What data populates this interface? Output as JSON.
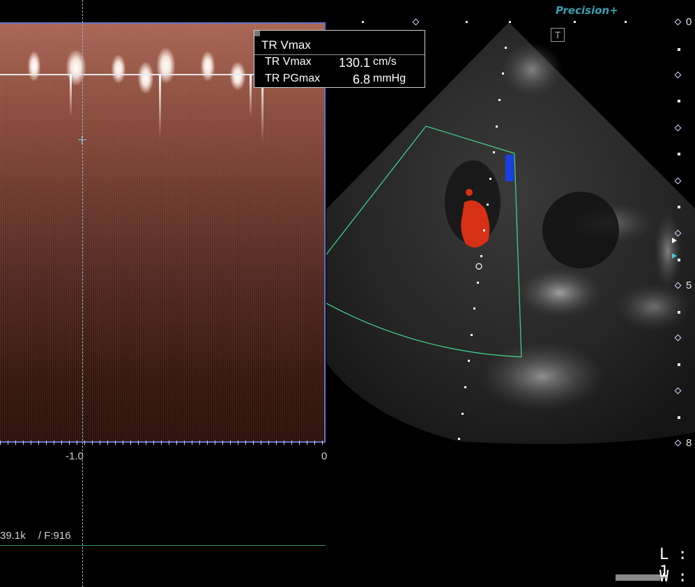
{
  "brand": "Precision+",
  "t_badge": "T",
  "measurement": {
    "title": "TR Vmax",
    "rows": [
      {
        "label": "TR Vmax",
        "value": "130.1",
        "unit": "cm/s"
      },
      {
        "label": "TR PGmax",
        "value": "6.8",
        "unit": "mmHg"
      }
    ]
  },
  "time_axis": {
    "ticks": [
      "-1.0",
      "0"
    ]
  },
  "depth_scale": {
    "labels": [
      "0",
      "5",
      "8"
    ]
  },
  "footer": {
    "scale_text": "39.1k",
    "frame_text": "/ F:916"
  },
  "window_level": {
    "level": "L : 1",
    "width": "W :"
  },
  "colors": {
    "spectrum": "#8f5040",
    "panel_border": "#6a72c8",
    "color_box": "#2fd07a",
    "flow_red": "#d63015",
    "flow_blue": "#1a40e0",
    "brand": "#3aa0b0"
  }
}
